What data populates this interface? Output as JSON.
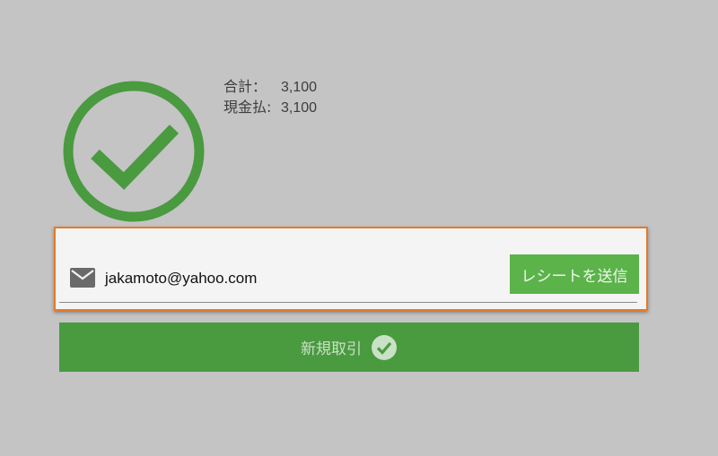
{
  "summary": {
    "total_label": "合計：",
    "total_value": "3,100",
    "cash_label": "現金払:",
    "cash_value": "3,100"
  },
  "receipt": {
    "email_value": "jakamoto@yahoo.com",
    "send_label": "レシートを送信"
  },
  "actions": {
    "new_transaction_label": "新規取引"
  },
  "colors": {
    "background": "#c4c4c4",
    "success_green": "#4a9a40",
    "button_green": "#5bb34a",
    "focus_orange": "#e87a26"
  },
  "icons": {
    "success": "check-circle-outline-icon",
    "email": "mail-icon",
    "new_transaction": "check-circle-icon"
  }
}
